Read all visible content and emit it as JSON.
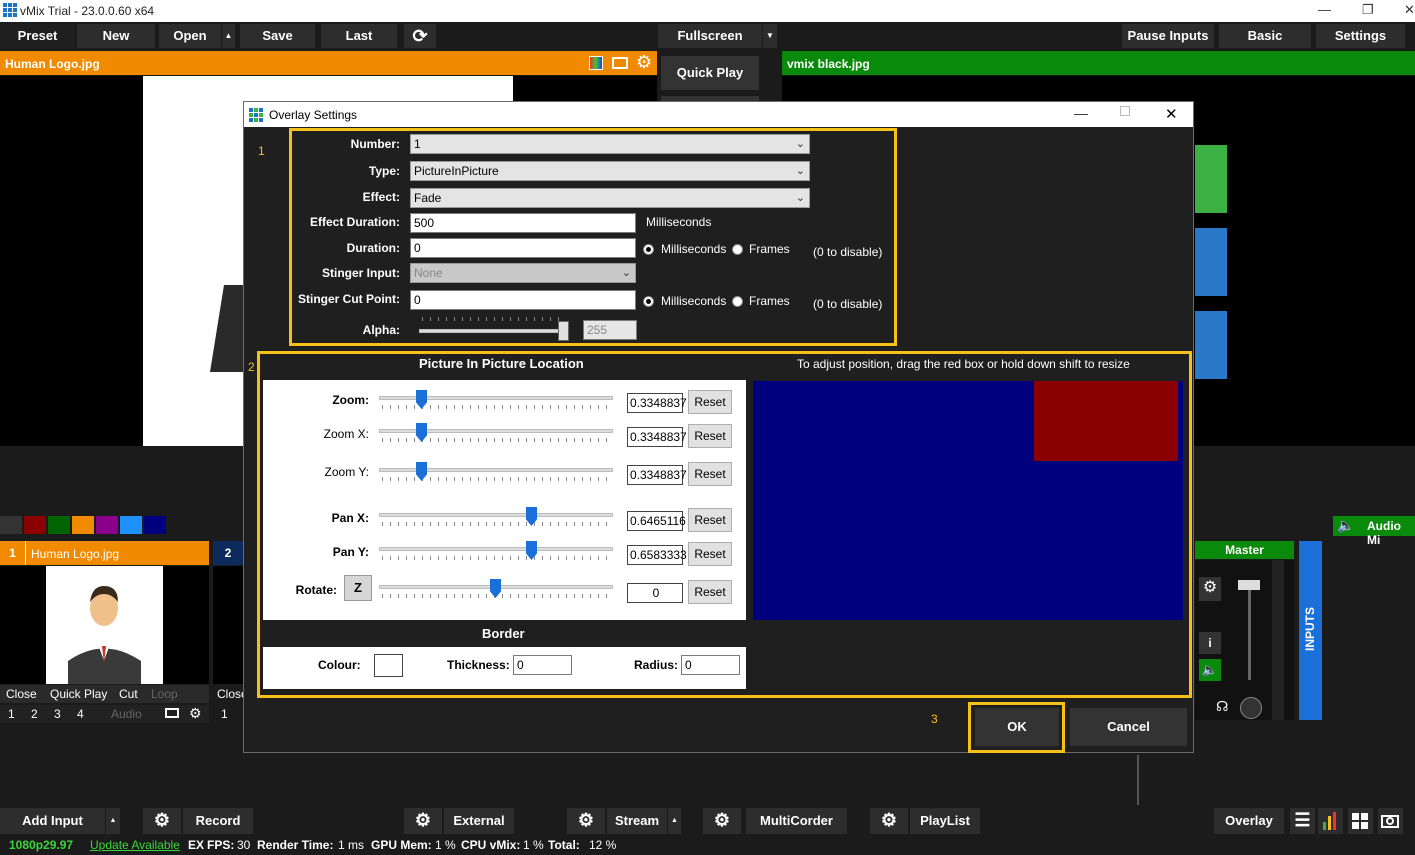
{
  "window": {
    "title": "vMix Trial - 23.0.0.60 x64"
  },
  "toolbar": {
    "preset": "Preset",
    "new": "New",
    "open": "Open",
    "save": "Save",
    "last": "Last",
    "fullscreen": "Fullscreen",
    "pause_inputs": "Pause Inputs",
    "basic": "Basic",
    "settings": "Settings"
  },
  "preview": {
    "title": "Human Logo.jpg"
  },
  "output": {
    "title": "vmix black.jpg"
  },
  "quick_play": "Quick Play",
  "dialog": {
    "title": "Overlay Settings",
    "markers": {
      "one": "1",
      "two": "2",
      "three": "3"
    },
    "number": {
      "label": "Number:",
      "value": "1"
    },
    "type": {
      "label": "Type:",
      "value": "PictureInPicture"
    },
    "effect": {
      "label": "Effect:",
      "value": "Fade"
    },
    "effect_duration": {
      "label": "Effect Duration:",
      "value": "500",
      "unit": "Milliseconds"
    },
    "duration": {
      "label": "Duration:",
      "value": "0",
      "ms": "Milliseconds",
      "frames": "Frames",
      "hint": "(0 to disable)"
    },
    "stinger_input": {
      "label": "Stinger Input:",
      "value": "None"
    },
    "stinger_cut": {
      "label": "Stinger Cut Point:",
      "value": "0",
      "ms": "Milliseconds",
      "frames": "Frames",
      "hint": "(0 to disable)"
    },
    "alpha": {
      "label": "Alpha:",
      "value": "255",
      "level": 1.0
    },
    "pip": {
      "heading": "Picture In Picture Location",
      "instructions": "To adjust position, drag the red box or hold down shift to resize",
      "zoom": {
        "label": "Zoom:",
        "value": "0.3348837",
        "level": 0.18
      },
      "zoom_x": {
        "label": "Zoom X:",
        "value": "0.3348837",
        "level": 0.18
      },
      "zoom_y": {
        "label": "Zoom Y:",
        "value": "0.3348837",
        "level": 0.18
      },
      "pan_x": {
        "label": "Pan X:",
        "value": "0.6465116",
        "level": 0.65
      },
      "pan_y": {
        "label": "Pan Y:",
        "value": "0.6583333",
        "level": 0.65
      },
      "rotate": {
        "label": "Rotate:",
        "z": "Z",
        "value": "0",
        "level": 0.5
      },
      "reset": "Reset"
    },
    "border": {
      "heading": "Border",
      "colour": "Colour:",
      "thickness": "Thickness:",
      "thickness_value": "0",
      "radius": "Radius:",
      "radius_value": "0"
    },
    "ok": "OK",
    "cancel": "Cancel"
  },
  "inputs": {
    "input1": {
      "num": "1",
      "title": "Human Logo.jpg",
      "close": "Close",
      "quick_play": "Quick Play",
      "cut": "Cut",
      "loop": "Loop",
      "n1": "1",
      "n2": "2",
      "n3": "3",
      "n4": "4",
      "audio": "Audio"
    },
    "input2": {
      "num": "2",
      "close": "Close",
      "n1": "1"
    }
  },
  "audio": {
    "mixer": "Audio Mi",
    "master": "Master",
    "inputs": "INPUTS",
    "info": "i"
  },
  "bottom": {
    "add_input": "Add Input",
    "record": "Record",
    "external": "External",
    "stream": "Stream",
    "multicorder": "MultiCorder",
    "playlist": "PlayList",
    "overlay": "Overlay"
  },
  "status": {
    "format": "1080p29.97",
    "update": "Update Available",
    "ex": "EX",
    "fps_label": "FPS:",
    "fps": "30",
    "render_label": "Render Time:",
    "render": "1 ms",
    "gpu_label": "GPU Mem:",
    "gpu": "1 %",
    "cpu_label": "CPU vMix:",
    "cpu": "1 %",
    "total_label": "Total:",
    "total": "12 %"
  },
  "colors": {
    "accent_orange": "#f28a00",
    "green": "#0a8a0a",
    "highlight": "#f5c018",
    "pip_blue": "#00007f",
    "pip_red": "#8b0000"
  }
}
